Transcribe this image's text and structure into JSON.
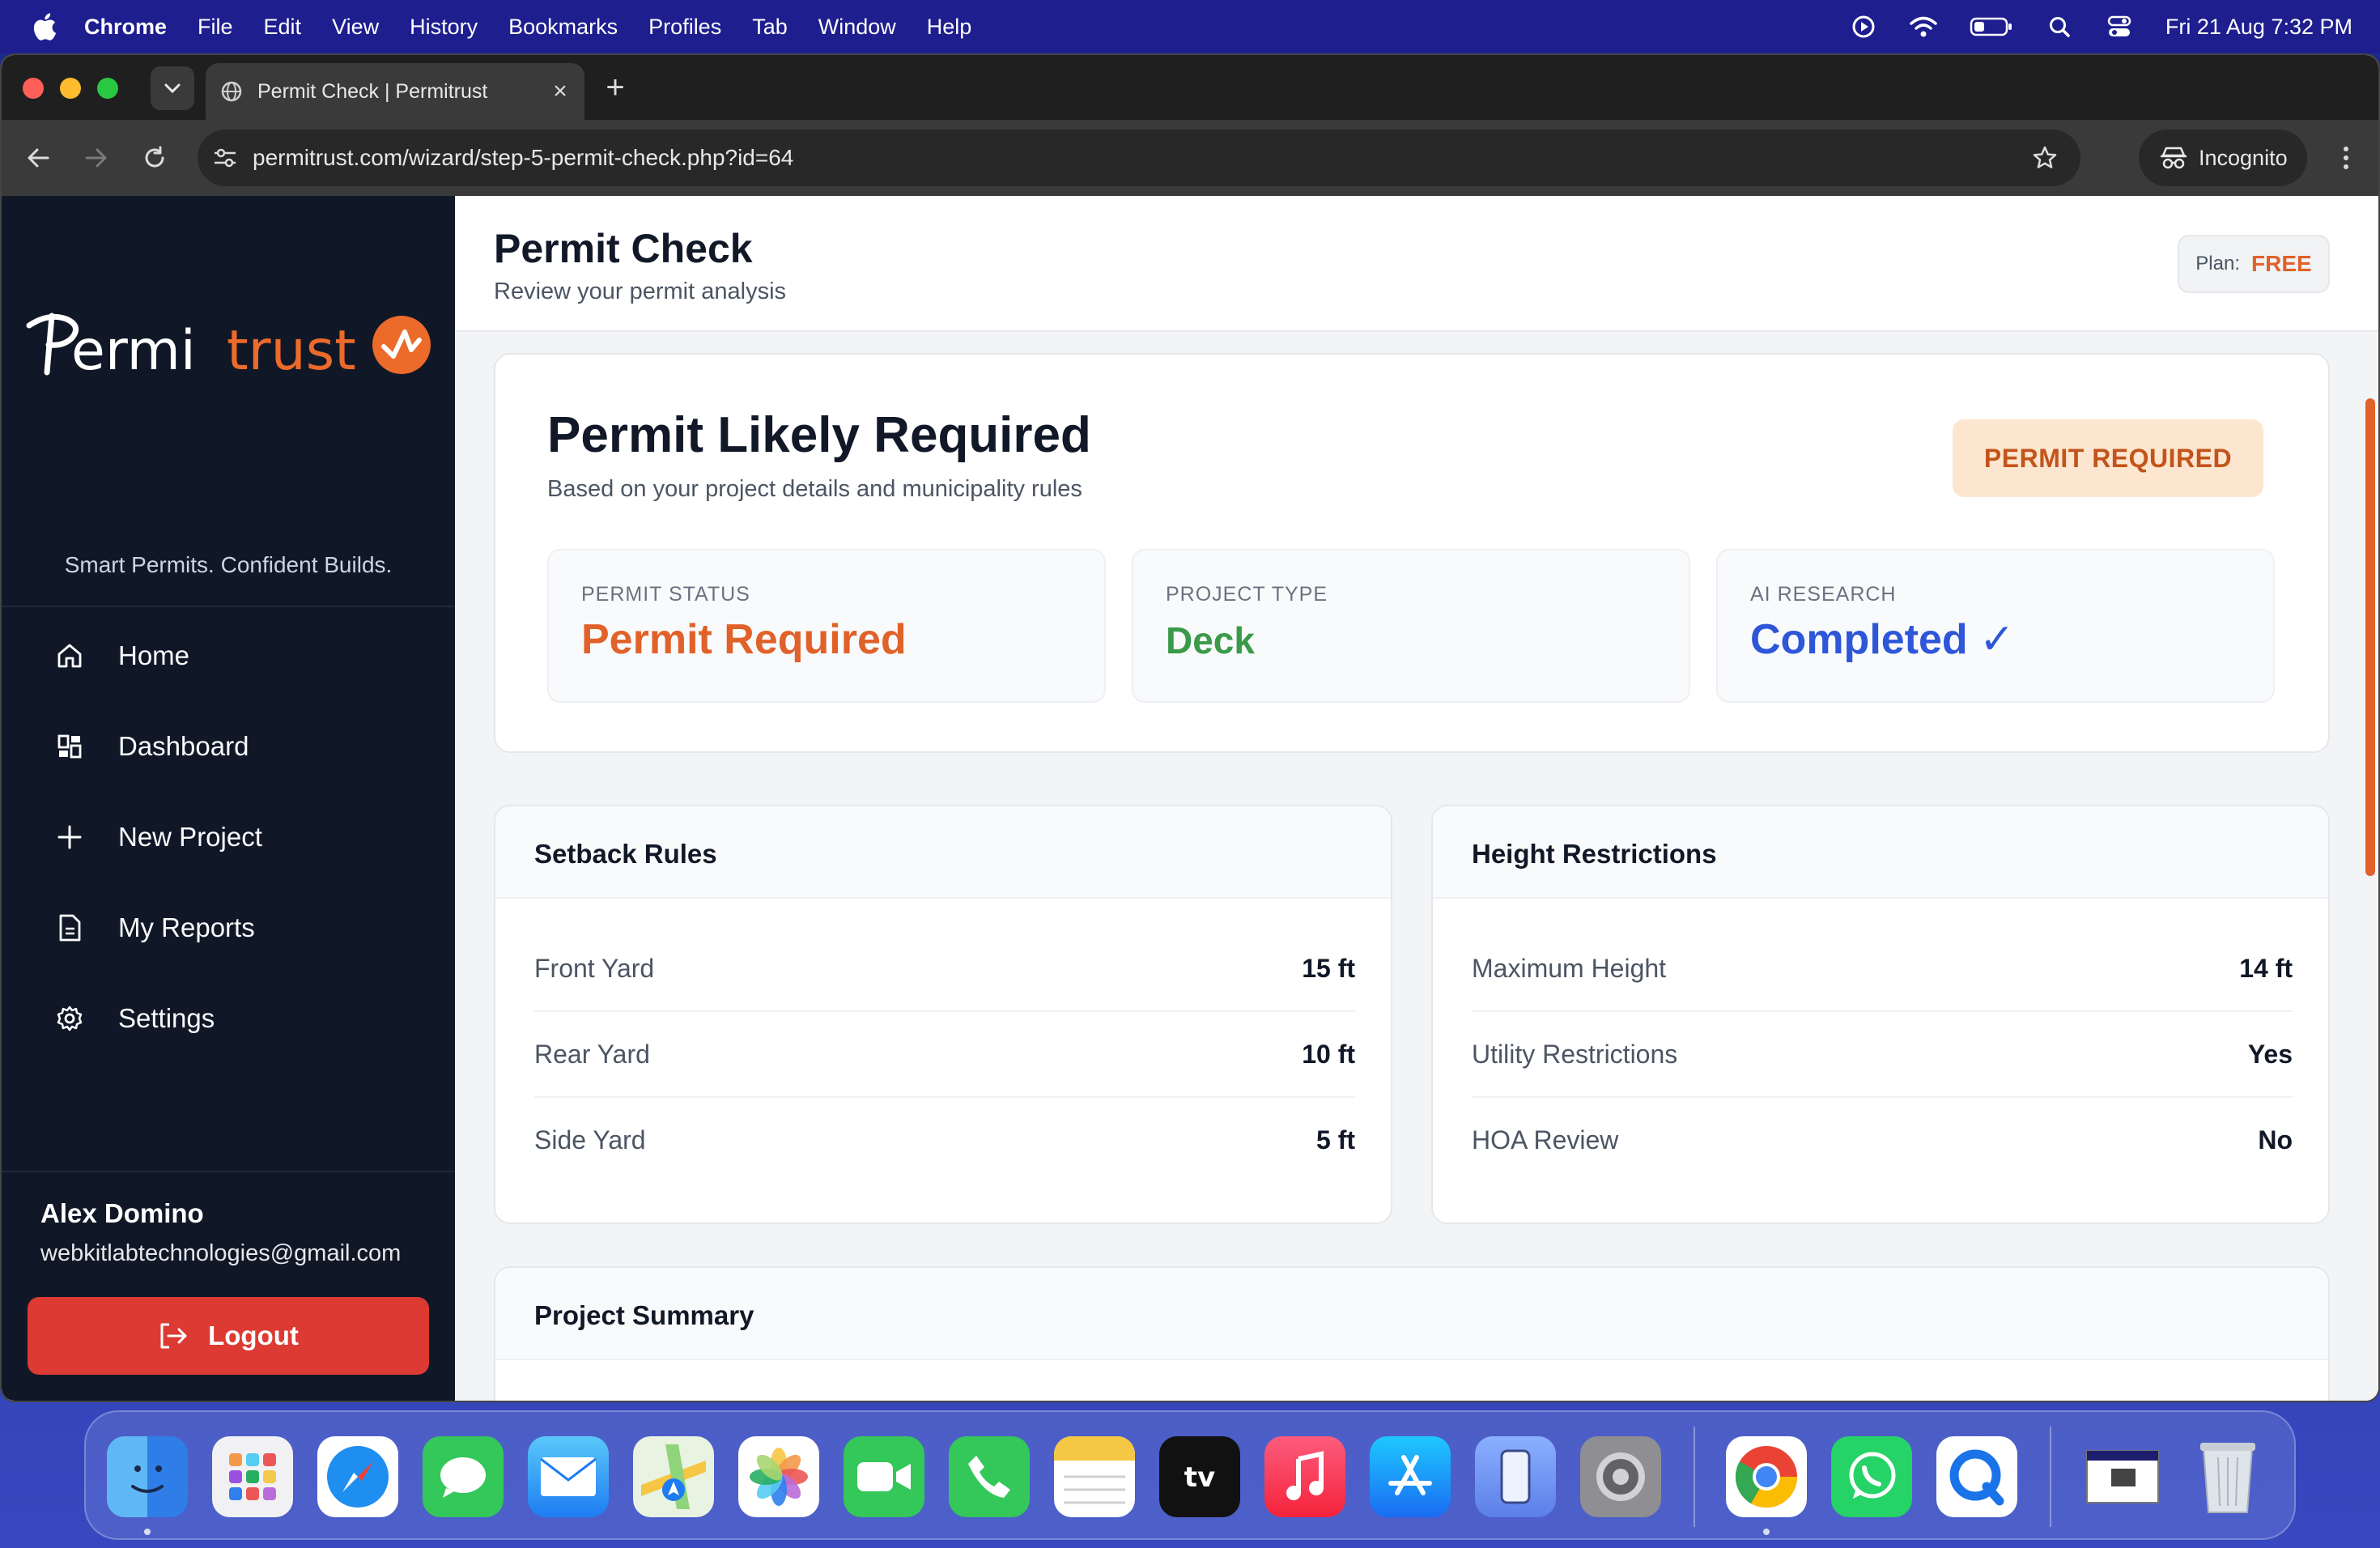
{
  "menubar": {
    "app": "Chrome",
    "items": [
      "File",
      "Edit",
      "View",
      "History",
      "Bookmarks",
      "Profiles",
      "Tab",
      "Window",
      "Help"
    ],
    "clock": "Fri 21 Aug  7:32 PM"
  },
  "browser": {
    "tab_title": "Permit Check | Permitrust",
    "url": "permitrust.com/wizard/step-5-permit-check.php?id=64",
    "incognito_label": "Incognito"
  },
  "sidebar": {
    "logo_text": "Permitrust",
    "tagline": "Smart Permits. Confident Builds.",
    "items": [
      {
        "label": "Home",
        "icon": "home-icon"
      },
      {
        "label": "Dashboard",
        "icon": "dashboard-icon"
      },
      {
        "label": "New Project",
        "icon": "plus-icon"
      },
      {
        "label": "My Reports",
        "icon": "document-icon"
      },
      {
        "label": "Settings",
        "icon": "gear-icon"
      }
    ],
    "user_name": "Alex Domino",
    "user_email": "webkitlabtechnologies@gmail.com",
    "logout_label": "Logout"
  },
  "header": {
    "title": "Permit Check",
    "subtitle": "Review your permit analysis",
    "plan_label": "Plan:",
    "plan_value": "FREE"
  },
  "result": {
    "title": "Permit Likely Required",
    "subtitle": "Based on your project details and municipality rules",
    "badge": "PERMIT REQUIRED",
    "stats": [
      {
        "label": "PERMIT STATUS",
        "value": "Permit Required"
      },
      {
        "label": "PROJECT TYPE",
        "value": "Deck"
      },
      {
        "label": "AI RESEARCH",
        "value": "Completed ✓"
      }
    ]
  },
  "setback": {
    "title": "Setback Rules",
    "rows": [
      {
        "label": "Front Yard",
        "value": "15 ft"
      },
      {
        "label": "Rear Yard",
        "value": "10 ft"
      },
      {
        "label": "Side Yard",
        "value": "5 ft"
      }
    ]
  },
  "height": {
    "title": "Height Restrictions",
    "rows": [
      {
        "label": "Maximum Height",
        "value": "14 ft"
      },
      {
        "label": "Utility Restrictions",
        "value": "Yes"
      },
      {
        "label": "HOA Review",
        "value": "No"
      }
    ]
  },
  "summary": {
    "title": "Project Summary"
  },
  "colors": {
    "accent_orange": "#e0622a",
    "sidebar_bg": "#101827",
    "logout_red": "#dc3a32",
    "status_green": "#3a9a4a",
    "status_blue": "#2d56d8"
  },
  "dock": [
    "finder-icon",
    "launchpad-icon",
    "safari-icon",
    "messages-icon",
    "mail-icon",
    "maps-icon",
    "photos-icon",
    "facetime-icon",
    "phone-icon",
    "notes-icon",
    "apple-tv-icon",
    "music-icon",
    "app-store-icon",
    "iphone-mirroring-icon",
    "system-settings-icon",
    "chrome-icon",
    "whatsapp-icon",
    "quicktime-icon",
    "downloads-stack-icon",
    "trash-icon"
  ]
}
